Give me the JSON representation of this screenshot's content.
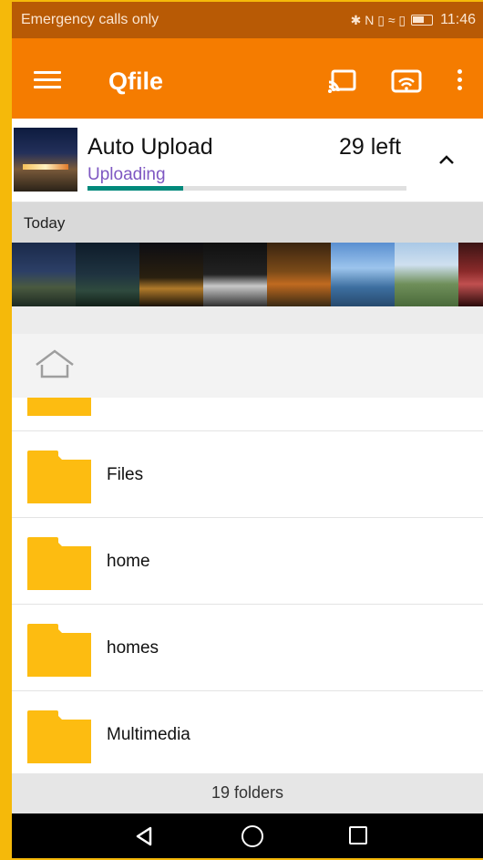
{
  "status_bar": {
    "carrier": "Emergency calls only",
    "time": "11:46",
    "icons": [
      "bluetooth-icon",
      "nfc-icon",
      "vibrate-icon",
      "wifi-icon",
      "sim-icon",
      "battery-icon"
    ],
    "glyphs": "✱ N ▯ ≈ ▯"
  },
  "app_bar": {
    "title": "Qfile",
    "color": "#f57c00"
  },
  "upload": {
    "title": "Auto Upload",
    "remaining": "29 left",
    "status": "Uploading",
    "progress": 0.3
  },
  "today": {
    "label": "Today",
    "photo_count": 8
  },
  "folders": [
    {
      "name": ""
    },
    {
      "name": "Files"
    },
    {
      "name": "home"
    },
    {
      "name": "homes"
    },
    {
      "name": "Multimedia"
    }
  ],
  "footer": {
    "summary": "19 folders"
  },
  "colors": {
    "accent": "#f57c00",
    "status_bar": "#b85a05",
    "folder": "#fdbc11",
    "progress": "#00897b",
    "uploading_text": "#7e57c2"
  }
}
